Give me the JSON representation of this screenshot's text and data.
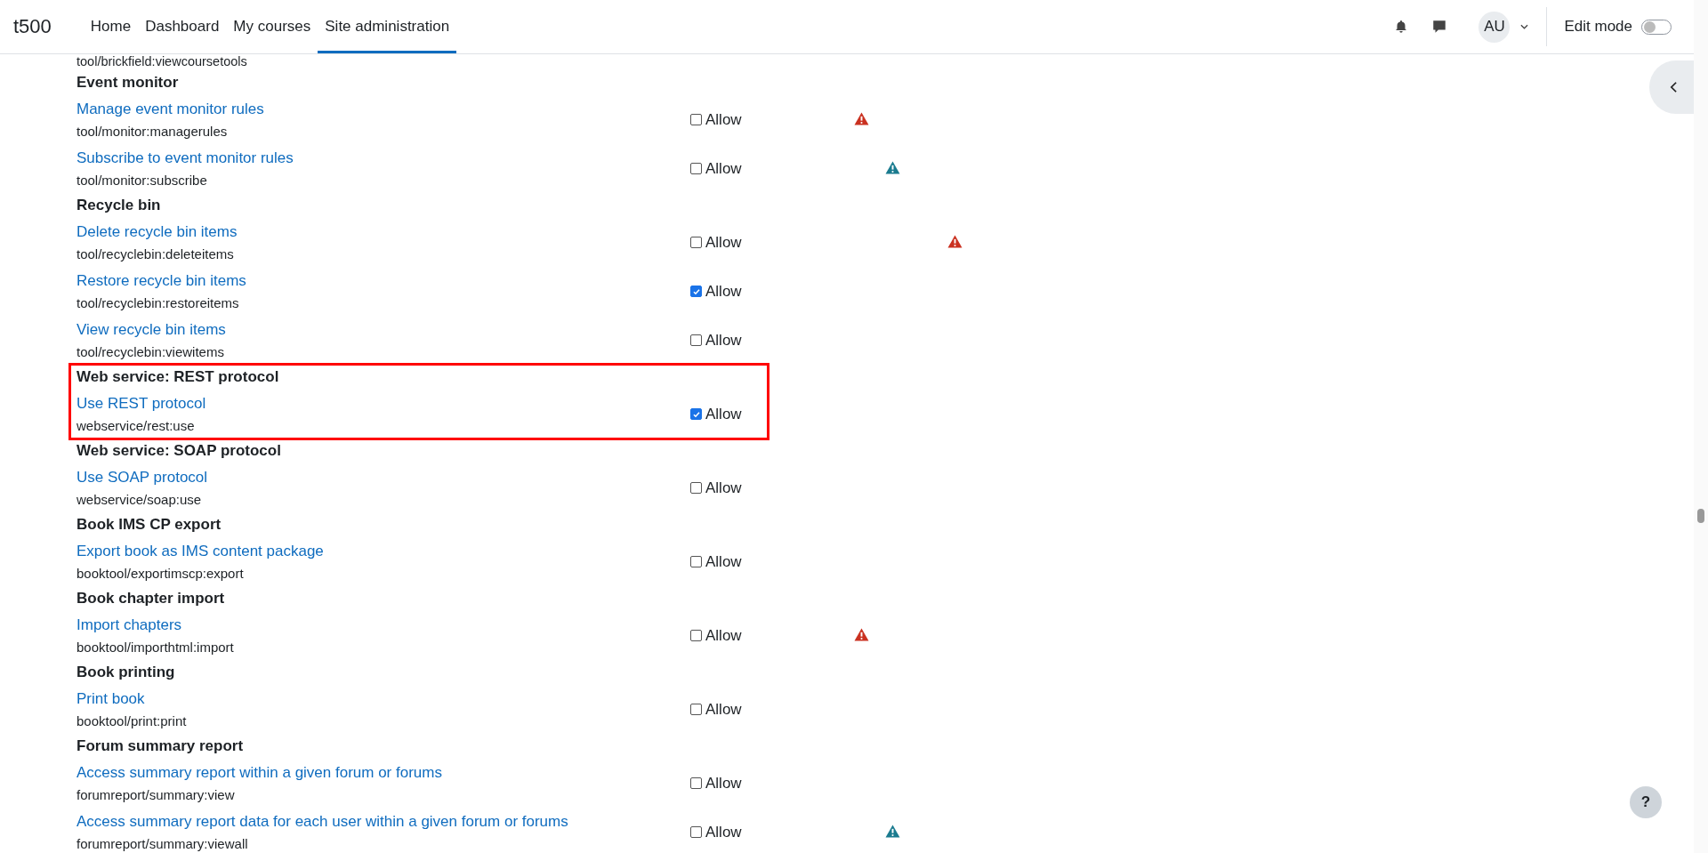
{
  "brand": "t500",
  "nav": [
    {
      "label": "Home",
      "selected": false
    },
    {
      "label": "Dashboard",
      "selected": false
    },
    {
      "label": "My courses",
      "selected": false
    },
    {
      "label": "Site administration",
      "selected": true
    }
  ],
  "user": {
    "initials": "AU"
  },
  "edit_mode": {
    "label": "Edit mode",
    "on": false
  },
  "cut_top_text": "tool/brickfield:viewcoursetools",
  "groups": [
    {
      "title": "Event monitor",
      "highlighted": false,
      "capabilities": [
        {
          "name": "Manage event monitor rules",
          "code": "tool/monitor:managerules",
          "allow": "Allow",
          "checked": false,
          "risks": [
            {
              "kind": "first",
              "color": "#ca3120"
            }
          ]
        },
        {
          "name": "Subscribe to event monitor rules",
          "code": "tool/monitor:subscribe",
          "allow": "Allow",
          "checked": false,
          "risks": [
            {
              "kind": "second",
              "color": "#1a7b8f"
            }
          ]
        }
      ]
    },
    {
      "title": "Recycle bin",
      "highlighted": false,
      "capabilities": [
        {
          "name": "Delete recycle bin items",
          "code": "tool/recyclebin:deleteitems",
          "allow": "Allow",
          "checked": false,
          "risks": [
            {
              "kind": "fourth",
              "color": "#ca3120"
            }
          ]
        },
        {
          "name": "Restore recycle bin items",
          "code": "tool/recyclebin:restoreitems",
          "allow": "Allow",
          "checked": true
        },
        {
          "name": "View recycle bin items",
          "code": "tool/recyclebin:viewitems",
          "allow": "Allow",
          "checked": false
        }
      ]
    },
    {
      "title": "Web service: REST protocol",
      "highlighted": true,
      "capabilities": [
        {
          "name": "Use REST protocol",
          "code": "webservice/rest:use",
          "allow": "Allow",
          "checked": true
        }
      ]
    },
    {
      "title": "Web service: SOAP protocol",
      "highlighted": false,
      "capabilities": [
        {
          "name": "Use SOAP protocol",
          "code": "webservice/soap:use",
          "allow": "Allow",
          "checked": false
        }
      ]
    },
    {
      "title": "Book IMS CP export",
      "highlighted": false,
      "capabilities": [
        {
          "name": "Export book as IMS content package",
          "code": "booktool/exportimscp:export",
          "allow": "Allow",
          "checked": false
        }
      ]
    },
    {
      "title": "Book chapter import",
      "highlighted": false,
      "capabilities": [
        {
          "name": "Import chapters",
          "code": "booktool/importhtml:import",
          "allow": "Allow",
          "checked": false,
          "risks": [
            {
              "kind": "first",
              "color": "#ca3120"
            }
          ]
        }
      ]
    },
    {
      "title": "Book printing",
      "highlighted": false,
      "capabilities": [
        {
          "name": "Print book",
          "code": "booktool/print:print",
          "allow": "Allow",
          "checked": false
        }
      ]
    },
    {
      "title": "Forum summary report",
      "highlighted": false,
      "capabilities": [
        {
          "name": "Access summary report within a given forum or forums",
          "code": "forumreport/summary:view",
          "allow": "Allow",
          "checked": false
        },
        {
          "name": "Access summary report data for each user within a given forum or forums",
          "code": "forumreport/summary:viewall",
          "allow": "Allow",
          "checked": false,
          "risks": [
            {
              "kind": "second",
              "color": "#1a7b8f"
            }
          ]
        }
      ]
    }
  ],
  "help": "?"
}
